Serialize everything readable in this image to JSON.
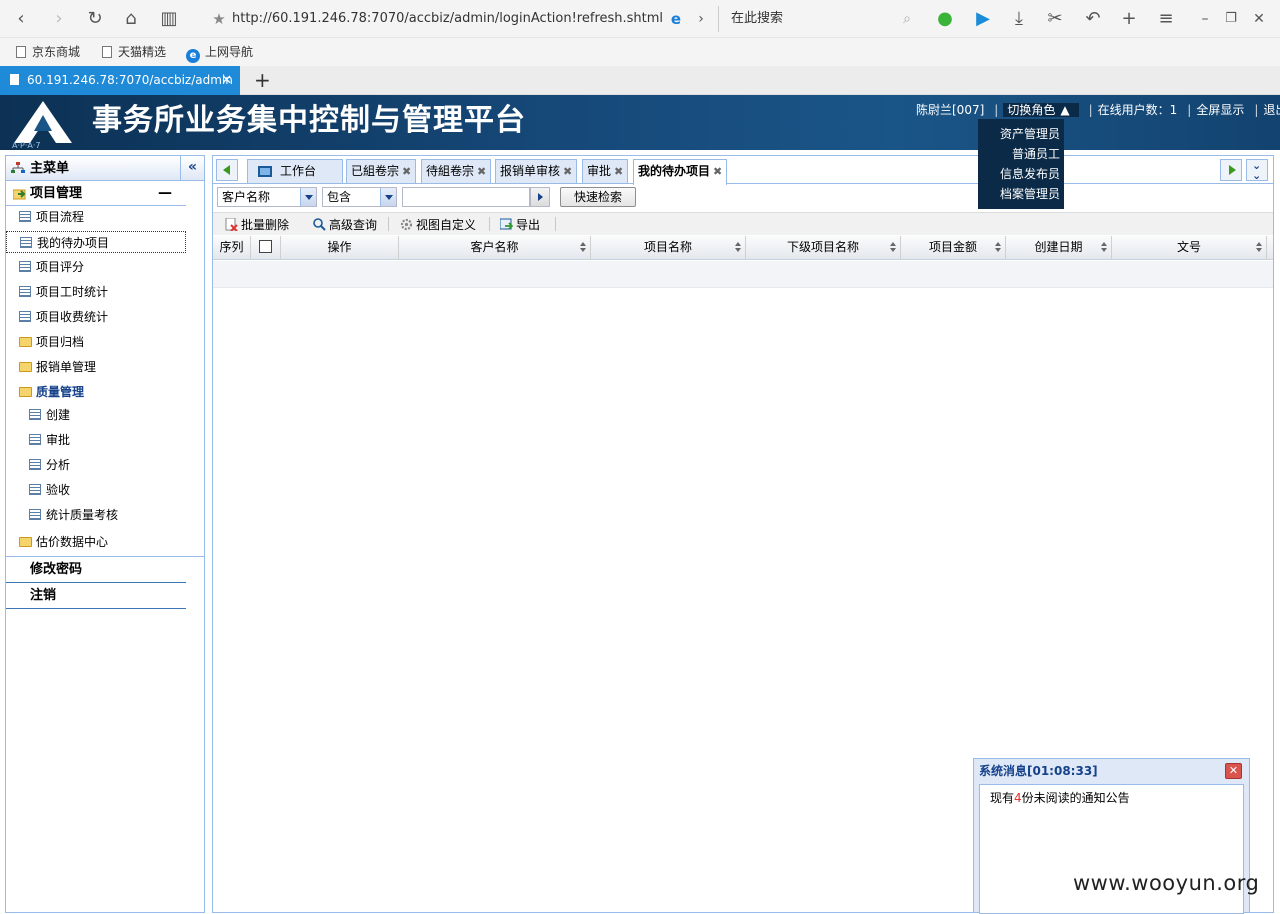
{
  "browser": {
    "url": "http://60.191.246.78:7070/accbiz/admin/loginAction!refresh.shtml#",
    "search_placeholder": "在此搜索",
    "bookmarks": [
      "京东商城",
      "天猫精选",
      "上网导航"
    ],
    "tab_title": "60.191.246.78:7070/accbiz/admin"
  },
  "header": {
    "title": "事务所业务集中控制与管理平台",
    "logo_text": "A·P·A·7",
    "user": "陈尉兰[007]",
    "switch_role": "切换角色",
    "online_users": "在线用户数：1",
    "fullscreen": "全屏显示",
    "logout": "退出",
    "roles": [
      "资产管理员",
      "普通员工",
      "信息发布员",
      "档案管理员"
    ]
  },
  "sidebar": {
    "title": "主菜单",
    "collapse_icon": "«",
    "section": "项目管理",
    "items": [
      "项目流程",
      "我的待办项目",
      "项目评分",
      "项目工时统计",
      "项目收费统计",
      "项目归档",
      "报销单管理"
    ],
    "quality": {
      "label": "质量管理",
      "children": [
        "创建",
        "审批",
        "分析",
        "验收",
        "统计质量考核"
      ]
    },
    "pricing": "估价数据中心",
    "change_password": "修改密码",
    "logoff": "注销"
  },
  "tabs": [
    {
      "label": "工作台",
      "closable": false
    },
    {
      "label": "已組卷宗",
      "closable": true
    },
    {
      "label": "待組卷宗",
      "closable": true
    },
    {
      "label": "报销单审核",
      "closable": true
    },
    {
      "label": "审批",
      "closable": true
    },
    {
      "label": "我的待办项目",
      "closable": true,
      "active": true
    }
  ],
  "search": {
    "field": "客户名称",
    "operator": "包含",
    "keyword": "",
    "button": "快速检索"
  },
  "toolbar": {
    "batch_delete": "批量删除",
    "advanced_query": "高级查询",
    "view_custom": "视图自定义",
    "export": "导出"
  },
  "grid": {
    "columns": [
      "序列",
      "操作",
      "客户名称",
      "项目名称",
      "下级项目名称",
      "项目金额",
      "创建日期",
      "文号"
    ]
  },
  "system_message": {
    "title": "系统消息[01:08:33]",
    "text_before": "现有",
    "count": "4",
    "text_after": "份未阅读的通知公告"
  },
  "watermark": "www.wooyun.org",
  "colors": {
    "header_bg": "#16497a",
    "panel_border": "#99bbe8",
    "browser_tab": "#1f8ad8",
    "link_blue": "#15428b"
  }
}
